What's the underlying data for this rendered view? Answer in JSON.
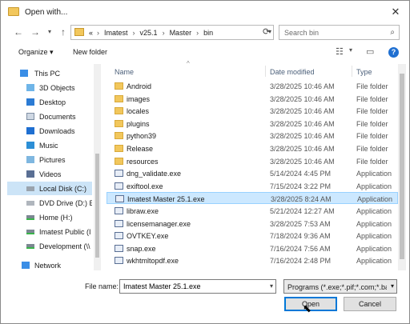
{
  "window": {
    "title": "Open with..."
  },
  "address": {
    "prefix": "«",
    "crumbs": [
      "Imatest",
      "v25.1",
      "Master",
      "bin"
    ],
    "search_placeholder": "Search bin"
  },
  "toolbar": {
    "organize": "Organize ▾",
    "new_folder": "New folder"
  },
  "nav_items": [
    {
      "label": "This PC",
      "icon": "pc-icon"
    },
    {
      "label": "3D Objects",
      "icon": "objects-3d-icon"
    },
    {
      "label": "Desktop",
      "icon": "desktop-icon"
    },
    {
      "label": "Documents",
      "icon": "documents-icon"
    },
    {
      "label": "Downloads",
      "icon": "downloads-icon"
    },
    {
      "label": "Music",
      "icon": "music-icon"
    },
    {
      "label": "Pictures",
      "icon": "pictures-icon"
    },
    {
      "label": "Videos",
      "icon": "videos-icon"
    },
    {
      "label": "Local Disk (C:)",
      "icon": "drive-icon"
    },
    {
      "label": "DVD Drive (D:) E",
      "icon": "dvd-icon"
    },
    {
      "label": "Home (H:)",
      "icon": "network-drive-icon"
    },
    {
      "label": "Imatest Public (I",
      "icon": "network-drive-icon"
    },
    {
      "label": "Development (\\\\",
      "icon": "network-drive-icon"
    },
    {
      "label": "Network",
      "icon": "network-icon"
    }
  ],
  "columns": {
    "name": "Name",
    "date": "Date modified",
    "type": "Type"
  },
  "files": [
    {
      "name": "Android",
      "date": "3/28/2025 10:46 AM",
      "type": "File folder",
      "kind": "folder"
    },
    {
      "name": "images",
      "date": "3/28/2025 10:46 AM",
      "type": "File folder",
      "kind": "folder"
    },
    {
      "name": "locales",
      "date": "3/28/2025 10:46 AM",
      "type": "File folder",
      "kind": "folder"
    },
    {
      "name": "plugins",
      "date": "3/28/2025 10:46 AM",
      "type": "File folder",
      "kind": "folder"
    },
    {
      "name": "python39",
      "date": "3/28/2025 10:46 AM",
      "type": "File folder",
      "kind": "folder"
    },
    {
      "name": "Release",
      "date": "3/28/2025 10:46 AM",
      "type": "File folder",
      "kind": "folder"
    },
    {
      "name": "resources",
      "date": "3/28/2025 10:46 AM",
      "type": "File folder",
      "kind": "folder"
    },
    {
      "name": "dng_validate.exe",
      "date": "5/14/2024 4:45 PM",
      "type": "Application",
      "kind": "app"
    },
    {
      "name": "exiftool.exe",
      "date": "7/15/2024 3:22 PM",
      "type": "Application",
      "kind": "app"
    },
    {
      "name": "Imatest Master 25.1.exe",
      "date": "3/28/2025 8:24 AM",
      "type": "Application",
      "kind": "app",
      "selected": true
    },
    {
      "name": "libraw.exe",
      "date": "5/21/2024 12:27 AM",
      "type": "Application",
      "kind": "app"
    },
    {
      "name": "licensemanager.exe",
      "date": "3/28/2025 7:53 AM",
      "type": "Application",
      "kind": "app"
    },
    {
      "name": "OVTKEY.exe",
      "date": "7/18/2024 9:36 AM",
      "type": "Application",
      "kind": "app"
    },
    {
      "name": "snap.exe",
      "date": "7/16/2024 7:56 AM",
      "type": "Application",
      "kind": "app"
    },
    {
      "name": "wkhtmltopdf.exe",
      "date": "7/16/2024 2:48 PM",
      "type": "Application",
      "kind": "app"
    }
  ],
  "bottom": {
    "file_name_label": "File name:",
    "file_name_value": "Imatest Master 25.1.exe",
    "filter": "Programs (*.exe;*.pif;*.com;*.bat",
    "open": "Open",
    "cancel": "Cancel"
  }
}
